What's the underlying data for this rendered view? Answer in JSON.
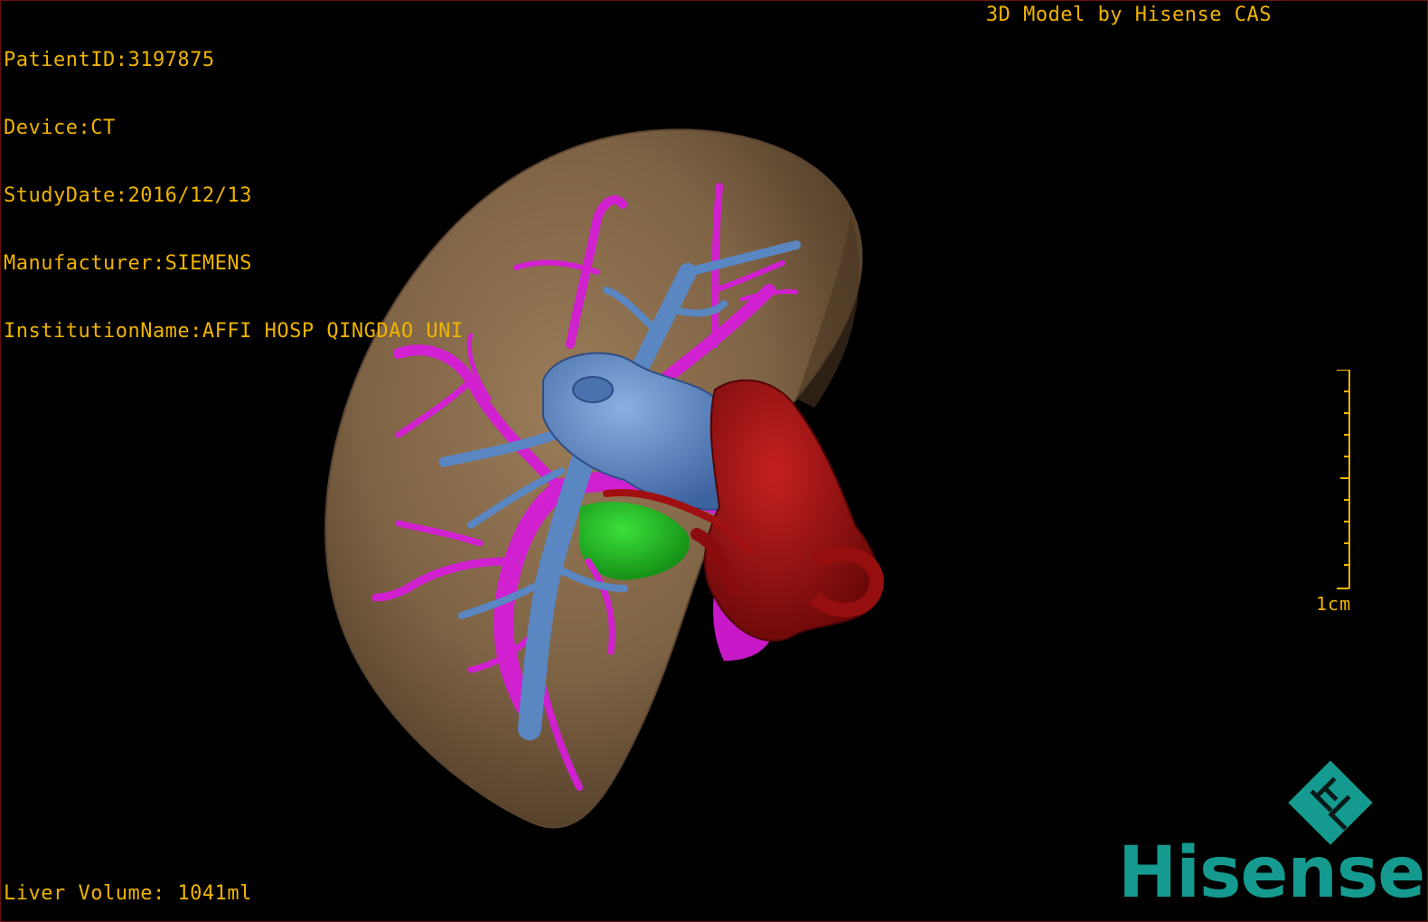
{
  "overlay": {
    "patient_id": "PatientID:3197875",
    "device": "Device:CT",
    "study_date": "StudyDate:2016/12/13",
    "manufacturer": "Manufacturer:SIEMENS",
    "institution": "InstitutionName:AFFI HOSP QINGDAO UNI",
    "credit": "3D Model by Hisense CAS",
    "liver_volume": "Liver Volume: 1041ml"
  },
  "scale": {
    "label": "1cm"
  },
  "brand": {
    "name": "Hisense",
    "logo_icon": "hisense-logo-icon",
    "color": "#159a8f"
  },
  "colors": {
    "overlay_text": "#f0b400",
    "liver": "#8a6e4e",
    "hepatic_vein": "#5a86c2",
    "portal_vein": "#d020d0",
    "artery": "#a01010",
    "gallbladder": "#20c020"
  }
}
